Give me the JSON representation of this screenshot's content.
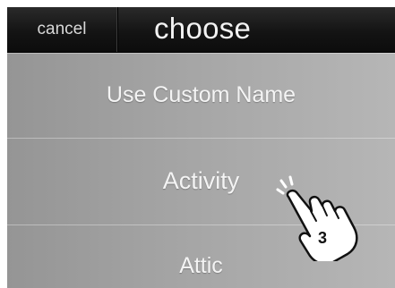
{
  "header": {
    "cancel_label": "cancel",
    "title": "choose"
  },
  "list": {
    "items": [
      {
        "label": "Use Custom Name"
      },
      {
        "label": "Activity"
      },
      {
        "label": "Attic"
      }
    ]
  },
  "gesture": {
    "icon": "tap-hand-icon",
    "tap_count": "3"
  },
  "colors": {
    "topbar": "#141414",
    "row": "#a8a8a8",
    "row_text": "#f4f4f4"
  }
}
